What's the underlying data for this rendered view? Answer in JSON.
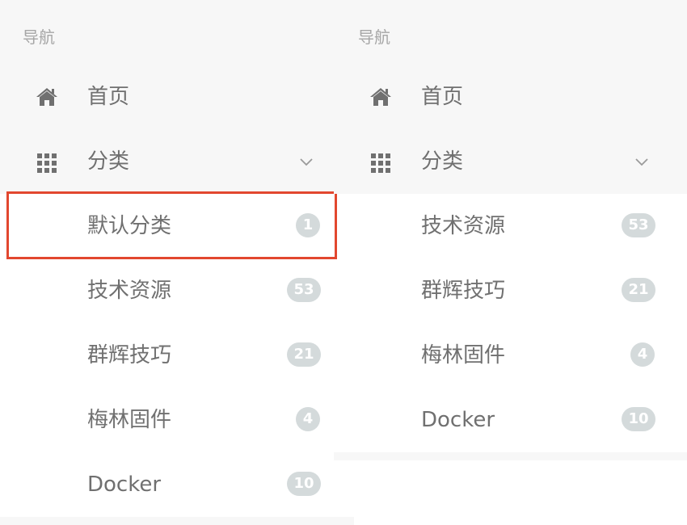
{
  "panels": [
    {
      "section_title": "导航",
      "home_label": "首页",
      "category_label": "分类",
      "subcategories": [
        {
          "label": "默认分类",
          "count": "1"
        },
        {
          "label": "技术资源",
          "count": "53"
        },
        {
          "label": "群辉技巧",
          "count": "21"
        },
        {
          "label": "梅林固件",
          "count": "4"
        },
        {
          "label": "Docker",
          "count": "10"
        }
      ],
      "highlighted_item": "默认分类"
    },
    {
      "section_title": "导航",
      "home_label": "首页",
      "category_label": "分类",
      "subcategories": [
        {
          "label": "技术资源",
          "count": "53"
        },
        {
          "label": "群辉技巧",
          "count": "21"
        },
        {
          "label": "梅林固件",
          "count": "4"
        },
        {
          "label": "Docker",
          "count": "10"
        }
      ]
    }
  ],
  "icons": {
    "home": "home-icon",
    "category": "grid-icon",
    "expand": "chevron-down-icon"
  },
  "colors": {
    "panel_background": "#f7f7f7",
    "badge_background": "#d4dadb",
    "highlight_border": "#e2472f",
    "text": "#707070",
    "section_title": "#a6a6a6"
  }
}
